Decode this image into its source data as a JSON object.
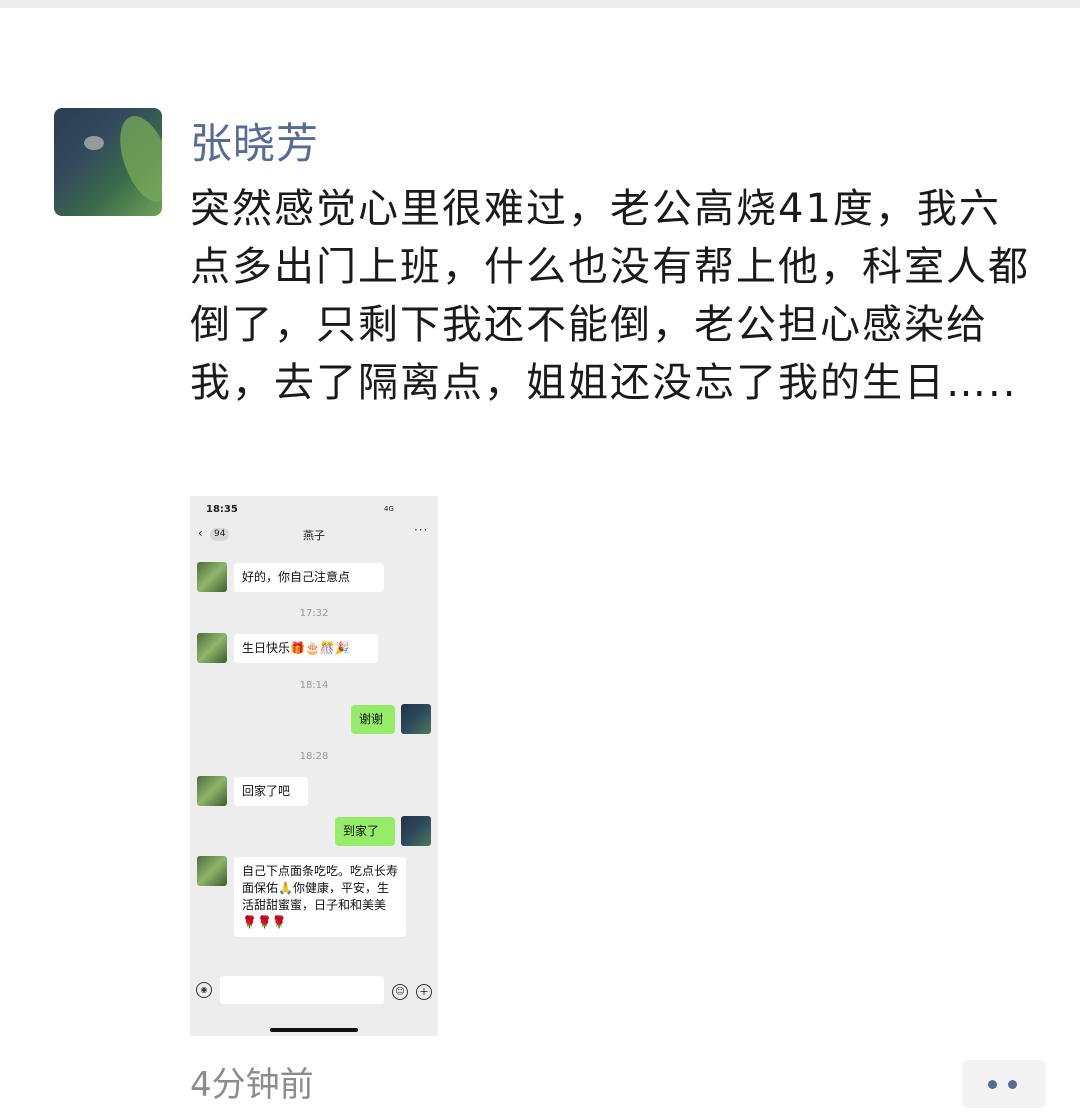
{
  "post": {
    "username": "张晓芳",
    "text": "突然感觉心里很难过，老公高烧41度，我六点多出门上班，什么也没有帮上他，科室人都倒了，只剩下我还不能倒，老公担心感染给我，去了隔离点，姐姐还没忘了我的生日…..",
    "time": "4分钟前"
  },
  "screenshot": {
    "status_time": "18:35",
    "status_signal": "4G",
    "back_glyph": "‹",
    "unread_badge": "94",
    "chat_title": "燕子",
    "more_glyph": "···",
    "messages": [
      {
        "from": "other",
        "text": "好的，你自己注意点"
      },
      {
        "type": "timestamp",
        "text": "17:32"
      },
      {
        "from": "other",
        "text": "生日快乐🎁🎂🎊🎉"
      },
      {
        "type": "timestamp",
        "text": "18:14"
      },
      {
        "from": "self",
        "text": "谢谢"
      },
      {
        "type": "timestamp",
        "text": "18:28"
      },
      {
        "from": "other",
        "text": "回家了吧"
      },
      {
        "from": "self",
        "text": "到家了"
      },
      {
        "from": "other",
        "text": "自己下点面条吃吃。吃点长寿面保佑🙏你健康，平安，生活甜甜蜜蜜，日子和和美美🌹🌹🌹"
      }
    ]
  },
  "icons": {
    "voice": "voice-icon",
    "emoji": "emoji-icon",
    "plus": "plus-icon",
    "more": "more-dots-icon"
  },
  "colors": {
    "username": "#576b95",
    "self_bubble": "#95ec69",
    "time_text": "#8c8c8c"
  }
}
